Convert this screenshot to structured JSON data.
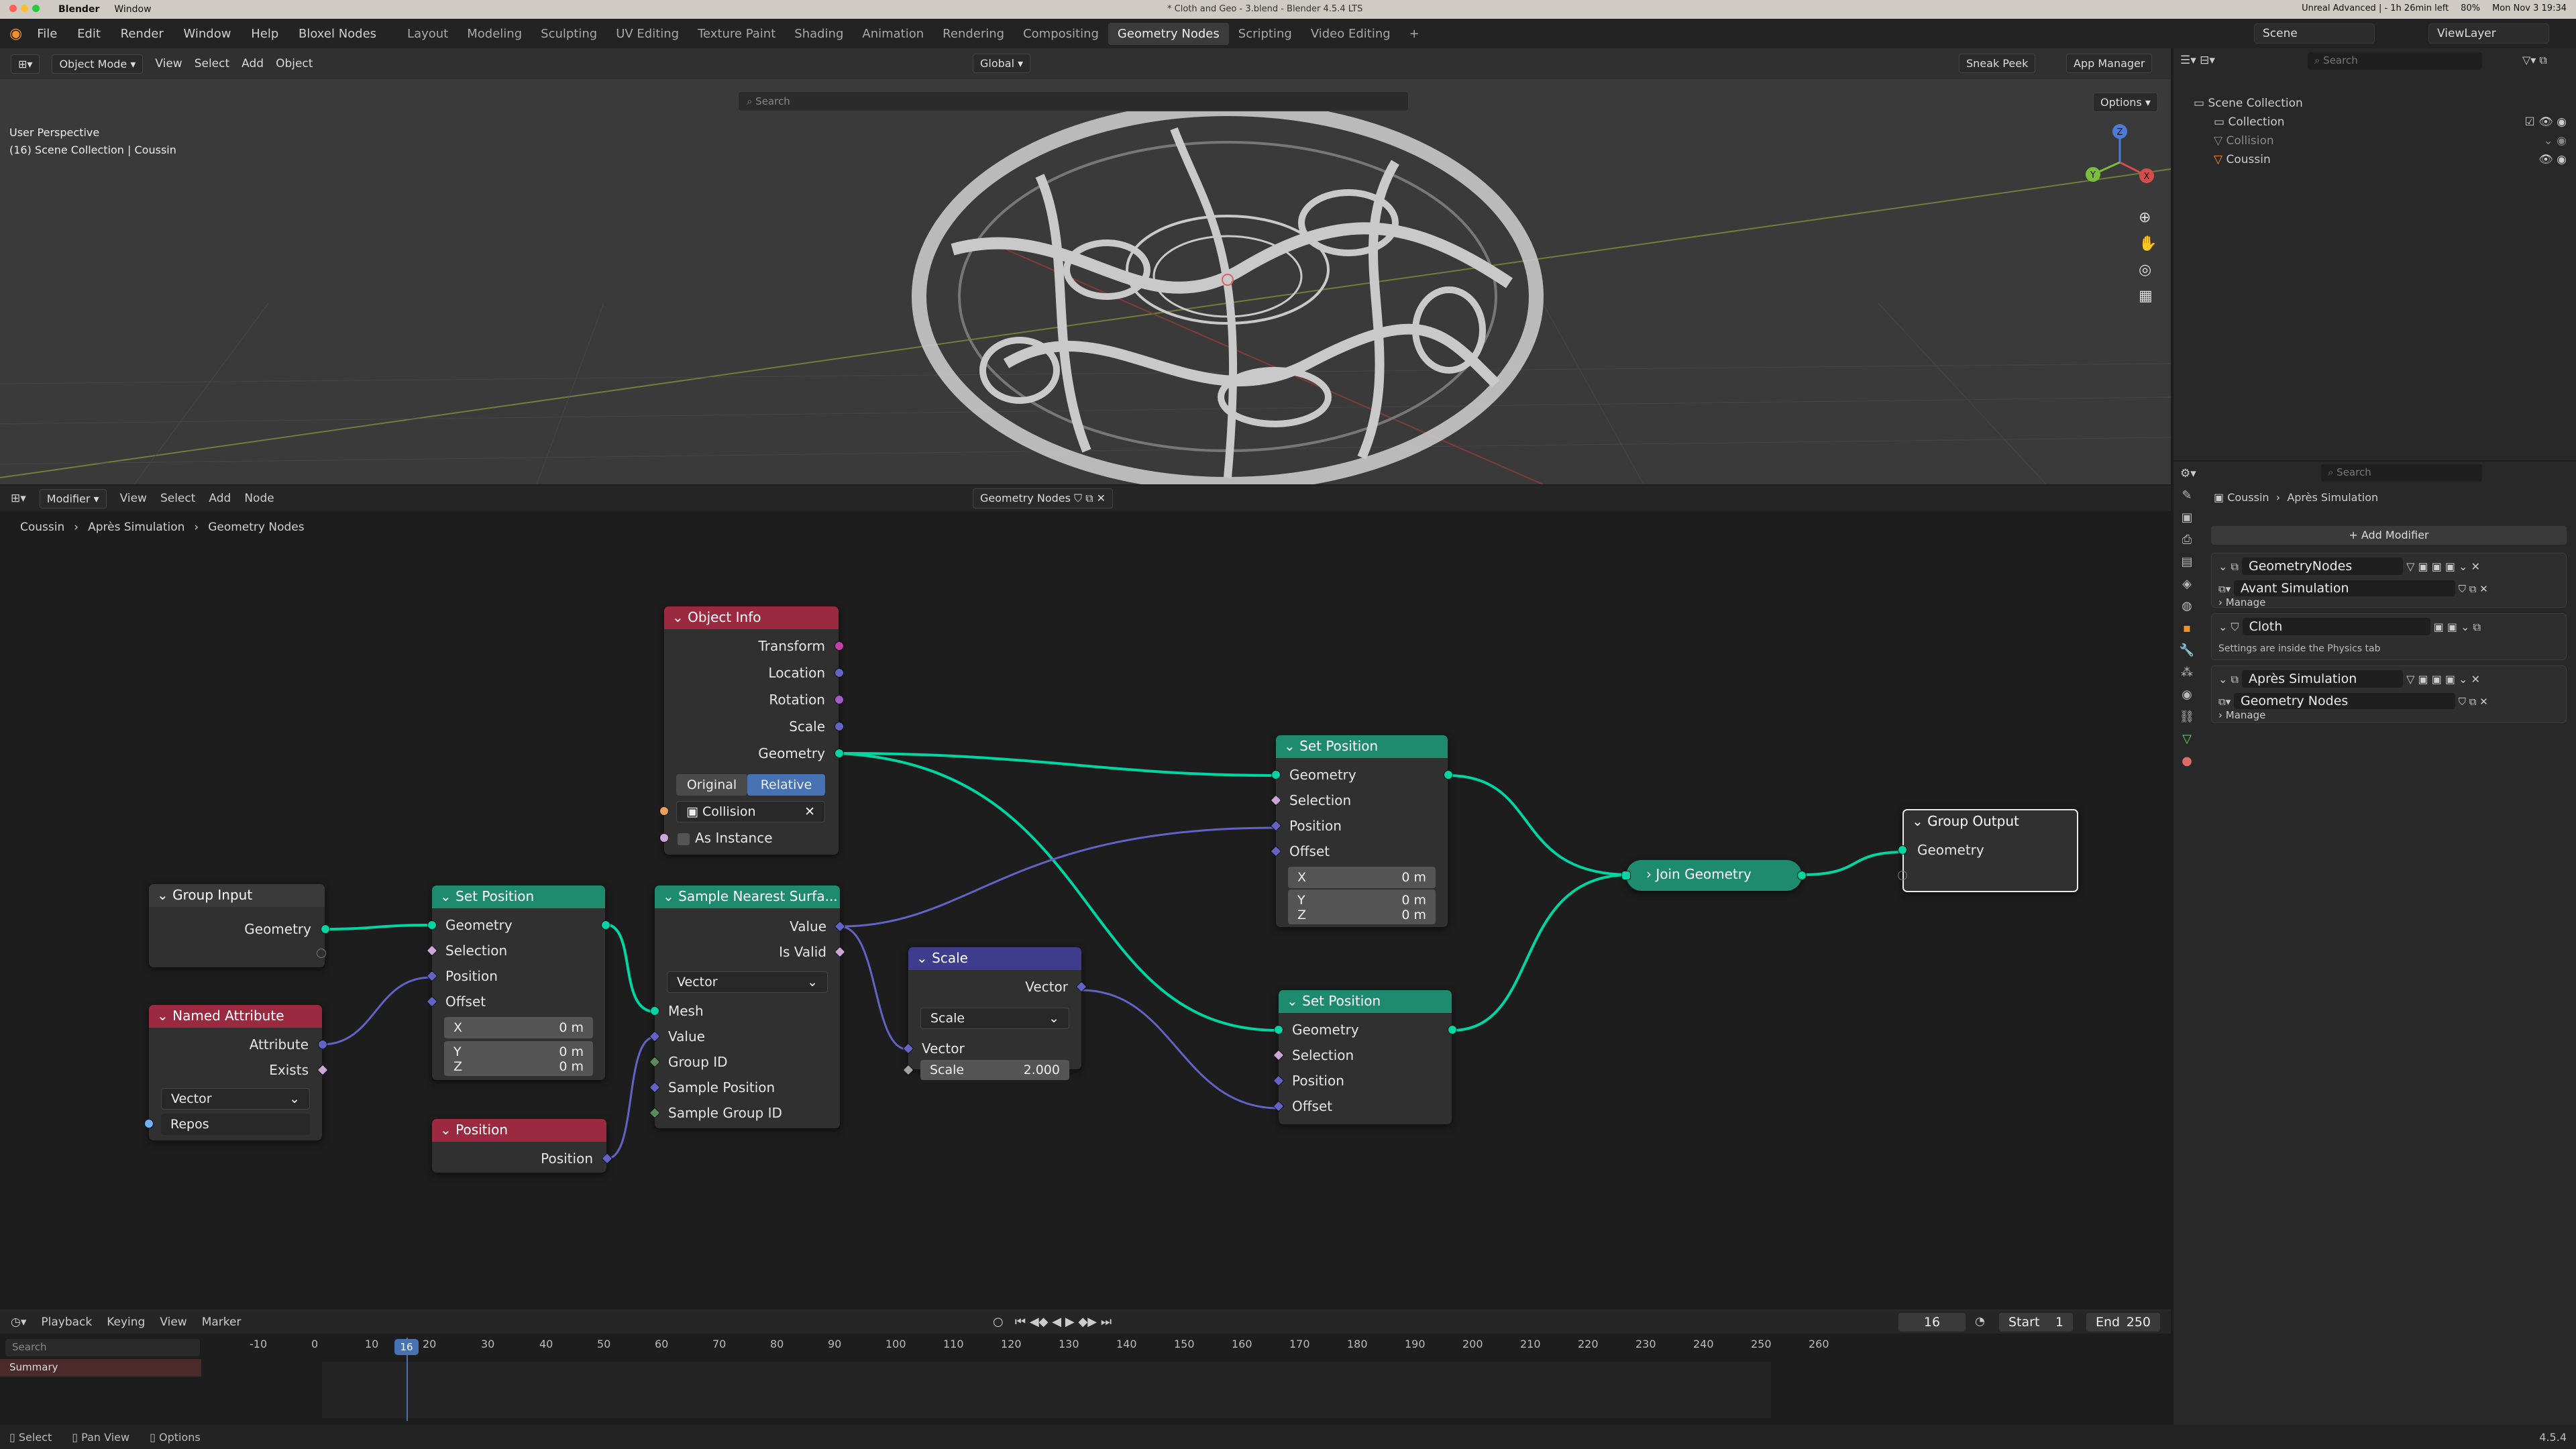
{
  "mac": {
    "app": "Blender",
    "window_menu": "Window",
    "title": "* Cloth and Geo - 3.blend - Blender 4.5.4 LTS",
    "status": "Unreal Advanced | - 1h 26min left",
    "battery": "80%",
    "clock": "Mon Nov 3  19:34"
  },
  "topbar": {
    "menu": [
      "File",
      "Edit",
      "Render",
      "Window",
      "Help",
      "Bloxel Nodes"
    ],
    "workspaces": [
      "Layout",
      "Modeling",
      "Sculpting",
      "UV Editing",
      "Texture Paint",
      "Shading",
      "Animation",
      "Rendering",
      "Compositing",
      "Geometry Nodes",
      "Scripting",
      "Video Editing"
    ],
    "active_workspace": "Geometry Nodes",
    "scene": "Scene",
    "view_layer": "ViewLayer"
  },
  "viewport": {
    "mode": "Object Mode",
    "menus": [
      "View",
      "Select",
      "Add",
      "Object"
    ],
    "transform": "Global",
    "sneak_peek": "Sneak Peek",
    "app_manager": "App Manager",
    "options": "Options",
    "search_placeholder": "Search",
    "perspective": "User Perspective",
    "collection_info": "(16) Scene Collection | Coussin",
    "gizmo_x": "X",
    "gizmo_y": "Y",
    "gizmo_z": "Z"
  },
  "node_editor": {
    "editor_menu": "Modifier",
    "menus": [
      "View",
      "Select",
      "Add",
      "Node"
    ],
    "tree_name": "Geometry Nodes",
    "breadcrumb": [
      "Coussin",
      "Après Simulation",
      "Geometry Nodes"
    ],
    "nodes": {
      "object_info": {
        "title": "Object Info",
        "outputs": [
          "Transform",
          "Location",
          "Rotation",
          "Scale",
          "Geometry"
        ],
        "btn_original": "Original",
        "btn_relative": "Relative",
        "object": "Collision",
        "as_instance": "As Instance"
      },
      "group_input": {
        "title": "Group Input",
        "output": "Geometry"
      },
      "named_attribute": {
        "title": "Named Attribute",
        "outputs": [
          "Attribute",
          "Exists"
        ],
        "type": "Vector",
        "name": "Repos"
      },
      "set_position_1": {
        "title": "Set Position",
        "inputs": [
          "Geometry",
          "Selection",
          "Position",
          "Offset"
        ],
        "x": "0 m",
        "y": "0 m",
        "z": "0 m",
        "labels": [
          "X",
          "Y",
          "Z"
        ]
      },
      "position": {
        "title": "Position",
        "output": "Position"
      },
      "sample_nearest": {
        "title": "Sample Nearest Surfa...",
        "outputs": [
          "Value",
          "Is Valid"
        ],
        "type": "Vector",
        "inputs": [
          "Mesh",
          "Value",
          "Group ID",
          "Sample Position",
          "Sample Group ID"
        ]
      },
      "scale": {
        "title": "Scale",
        "output": "Vector",
        "mode": "Scale",
        "input": "Vector",
        "scale_label": "Scale",
        "scale_value": "2.000"
      },
      "set_position_2": {
        "title": "Set Position",
        "inputs": [
          "Geometry",
          "Selection",
          "Position",
          "Offset"
        ],
        "x": "0 m",
        "y": "0 m",
        "z": "0 m",
        "labels": [
          "X",
          "Y",
          "Z"
        ]
      },
      "set_position_3": {
        "title": "Set Position",
        "inputs": [
          "Geometry",
          "Selection",
          "Position",
          "Offset"
        ]
      },
      "join_geometry": {
        "title": "Join Geometry"
      },
      "group_output": {
        "title": "Group Output",
        "input": "Geometry"
      }
    }
  },
  "timeline": {
    "menus": [
      "Playback",
      "Keying",
      "View",
      "Marker"
    ],
    "current_frame": "16",
    "start_label": "Start",
    "start": "1",
    "end_label": "End",
    "end": "250",
    "search_placeholder": "Search",
    "summary": "Summary",
    "ticks": [
      "-10",
      "0",
      "10",
      "20",
      "30",
      "40",
      "50",
      "60",
      "70",
      "80",
      "90",
      "100",
      "110",
      "120",
      "130",
      "140",
      "150",
      "160",
      "170",
      "180",
      "190",
      "200",
      "210",
      "220",
      "230",
      "240",
      "250",
      "260"
    ]
  },
  "outliner": {
    "search_placeholder": "Search",
    "scene_collection": "Scene Collection",
    "items": [
      "Collection",
      "Collision",
      "Coussin"
    ]
  },
  "properties": {
    "search_placeholder": "Search",
    "object": "Coussin",
    "modifier": "Après Simulation",
    "add_modifier": "Add Modifier",
    "mod1_name": "GeometryNodes",
    "mod1_tree": "Avant Simulation",
    "manage": "Manage",
    "mod2_name": "Cloth",
    "cloth_note": "Settings are inside the Physics tab",
    "mod3_name": "Après Simulation",
    "mod3_tree": "Geometry Nodes"
  },
  "statusbar": {
    "items": [
      "Select",
      "Pan View",
      "Options"
    ],
    "version": "4.5.4"
  },
  "colors": {
    "geometry": "#00d6a3",
    "vector": "#6363c7",
    "bool": "#cca6d6",
    "int": "#598c5c",
    "float": "#a1a1a1",
    "object": "#ed9e5c",
    "node_geo_header": "#1e8a6e",
    "node_input_header": "#9b2a41",
    "node_vector_header": "#3e3c8d"
  }
}
